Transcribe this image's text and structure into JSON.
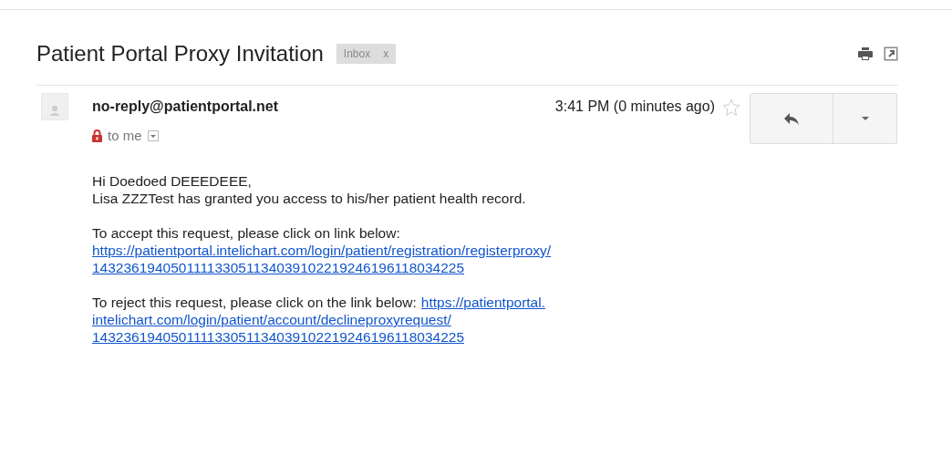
{
  "subject": "Patient Portal Proxy Invitation",
  "label": {
    "text": "Inbox",
    "remove": "x"
  },
  "message": {
    "sender": "no-reply@patientportal.net",
    "time": "3:41 PM (0 minutes ago)",
    "starred": false,
    "recipient": "to me"
  },
  "body": {
    "greeting": "Hi Doedoed DEEEDEEE,",
    "intro": "Lisa ZZZTest has granted you access to his/her patient health record.",
    "accept_text": "To accept this request, please click on link below:",
    "accept_link": [
      "https://patientportal.intelichart.com/login/patient/registration/registerproxy/",
      "143236194050111133051134039102219246196118034225"
    ],
    "reject_text": "To reject this request, please click on the link below:",
    "reject_link": [
      "https://patientportal.",
      "intelichart.com/login/patient/account/declineproxyrequest/",
      "143236194050111133051134039102219246196118034225"
    ]
  }
}
